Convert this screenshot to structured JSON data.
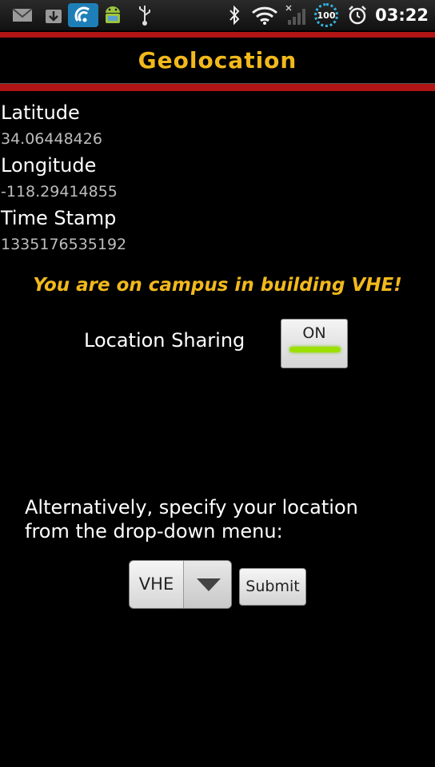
{
  "status_bar": {
    "time": "03:22",
    "battery_level": "100",
    "icons": [
      "gmail-icon",
      "download-icon",
      "wifi-hotspot-app-icon",
      "android-icon",
      "usb-icon",
      "bluetooth-icon",
      "wifi-icon",
      "signal-icon",
      "battery-icon",
      "alarm-icon"
    ]
  },
  "header": {
    "title": "Geolocation"
  },
  "location": {
    "latitude_label": "Latitude",
    "latitude_value": "34.06448426",
    "longitude_label": "Longitude",
    "longitude_value": "-118.29414855",
    "timestamp_label": "Time Stamp",
    "timestamp_value": "1335176535192"
  },
  "campus_message": "You are on campus in building VHE!",
  "sharing": {
    "label": "Location Sharing",
    "toggle_state": "ON"
  },
  "alternative": {
    "instructions": "Alternatively, specify your location from the drop-down menu:",
    "selected_building": "VHE",
    "submit_label": "Submit"
  },
  "colors": {
    "accent": "#f2b91c",
    "rule": "#b01414",
    "background": "#000000"
  }
}
